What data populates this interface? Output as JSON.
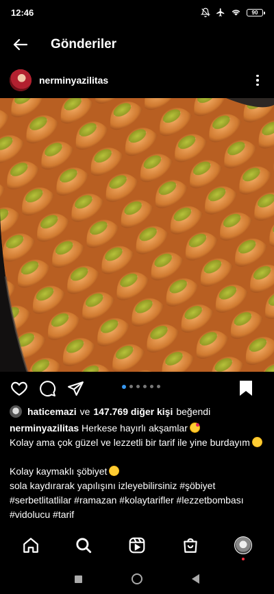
{
  "status_bar": {
    "time": "12:46",
    "battery": "90",
    "icons": [
      "alarm-off-icon",
      "airplane-icon",
      "wifi-icon",
      "battery-icon"
    ]
  },
  "header": {
    "title": "Gönderiler",
    "back_icon": "arrow-left-icon"
  },
  "post": {
    "username": "nerminyazilitas",
    "more_icon": "more-vertical-icon",
    "image_description_icon": "photo",
    "carousel": {
      "count": 6,
      "active_index": 0
    },
    "actions": {
      "like_icon": "heart-outline-icon",
      "comment_icon": "comment-icon",
      "share_icon": "send-icon",
      "save_icon": "bookmark-filled-icon"
    },
    "likes": {
      "liker": "haticemazi",
      "connector": "ve",
      "others": "147.769 diğer kişi",
      "suffix": "beğendi"
    },
    "caption": {
      "author": "nerminyazilitas",
      "line1_text": "Herkese hayırlı akşamlar",
      "line2": "Kolay ama çok güzel ve lezzetli bir tarif ile yine burdayım",
      "line3": "Kolay kaymaklı şöbiyet",
      "line4": "sola kaydırarak yapılışını izleyebilirsiniz #şöbiyet",
      "line5": "#serbetlitatlilar #ramazan #kolaytarifler #lezzetbombası",
      "line6": "#vidolucu #tarif"
    }
  },
  "bottom_nav": {
    "items": [
      "home-icon",
      "search-icon",
      "reels-icon",
      "shop-icon",
      "profile-avatar"
    ]
  },
  "colors": {
    "background": "#000000",
    "accent": "#3797f0",
    "notification": "#ff3040"
  }
}
